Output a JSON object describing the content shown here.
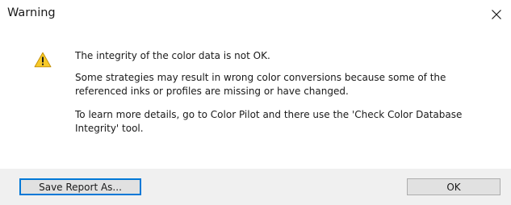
{
  "window": {
    "title": "Warning",
    "close_icon": "close-icon"
  },
  "message": {
    "icon": "warning-icon",
    "line1": "The integrity of the color data is not OK.",
    "line2a": "Some strategies may result in wrong color conversions because some of the",
    "line2b": "referenced inks or profiles are missing or have changed.",
    "line3a": "To learn more details, go to Color Pilot and there use the 'Check Color Database",
    "line3b": "Integrity' tool."
  },
  "buttons": {
    "save_report": "Save Report As...",
    "ok": "OK"
  },
  "colors": {
    "footer_bg": "#f0f0f0",
    "button_bg": "#e1e1e1",
    "focus_border": "#0078d7",
    "warning_yellow": "#f7c928"
  }
}
